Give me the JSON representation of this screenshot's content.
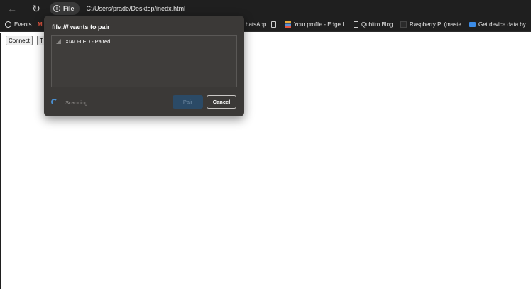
{
  "browser": {
    "back_glyph": "←",
    "reload_glyph": "↻",
    "site_chip_label": "File",
    "info_glyph": "i",
    "url": "C:/Users/prade/Desktop/inedx.html"
  },
  "bookmarks": [
    {
      "label": "Events",
      "icon": "threads-icon"
    },
    {
      "label": "M",
      "icon": "gmail-icon"
    },
    {
      "label": "hatsApp",
      "icon": "whatsapp-icon"
    },
    {
      "label": "",
      "icon": "page-icon"
    },
    {
      "label": "Your profile - Edge I...",
      "icon": "stack-icon"
    },
    {
      "label": "Qubitro Blog",
      "icon": "page-icon"
    },
    {
      "label": "Raspberry Pi (maste...",
      "icon": "square-icon"
    },
    {
      "label": "Get device data by...",
      "icon": "book-icon"
    }
  ],
  "page": {
    "connect_label": "Connect",
    "second_button_label": "T"
  },
  "dialog": {
    "title": "file:/// wants to pair",
    "device_name": "XIAO-LED - Paired",
    "status_text": "Scanning...",
    "pair_label": "Pair",
    "cancel_label": "Cancel"
  },
  "colors": {
    "chrome_bg": "#1f1f1f",
    "dialog_bg": "#3b3937",
    "accent_spinner": "#4a8fd0",
    "pair_disabled_bg": "#2b4a66"
  }
}
